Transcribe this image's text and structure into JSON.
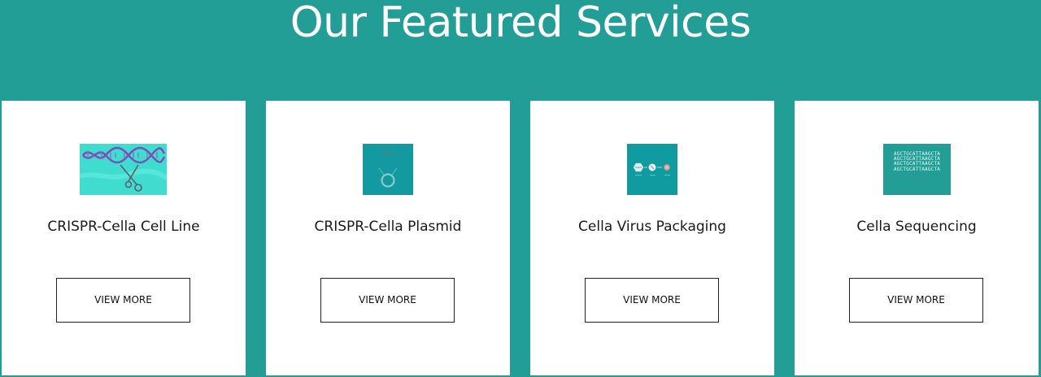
{
  "section": {
    "title": "Our Featured Services"
  },
  "colors": {
    "background": "#239e96",
    "card": "#ffffff",
    "thumb_teal": "#109ba0",
    "thumb_cyan": "#40dccf",
    "dna_purple": "#7b4fb8"
  },
  "services": [
    {
      "title": "CRISPR-Cella Cell Line",
      "icon": "dna-scissors-icon",
      "button_label": "VIEW MORE"
    },
    {
      "title": "CRISPR-Cella Plasmid",
      "icon": "plasmid-icon",
      "button_label": "VIEW MORE"
    },
    {
      "title": "Cella Virus Packaging",
      "icon": "virus-packaging-icon",
      "button_label": "VIEW MORE"
    },
    {
      "title": "Cella Sequencing",
      "icon": "sequencing-icon",
      "button_label": "VIEW MORE",
      "sequence_lines": [
        "AGCTGCATTAAGCTA",
        "AGCTGCATTAAGCTA",
        "AGCTGCATTAAGCTA",
        "AGCTGCATTAAGCTA"
      ]
    }
  ]
}
